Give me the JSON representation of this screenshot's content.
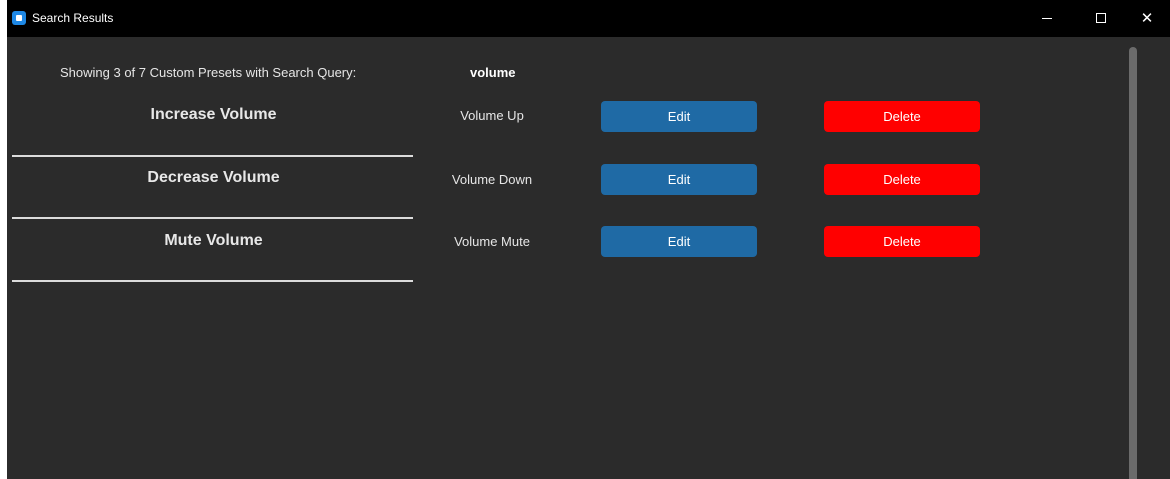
{
  "window": {
    "title": "Search Results",
    "controls": {
      "minimize": "minimize",
      "maximize": "maximize",
      "close": "✕"
    }
  },
  "search": {
    "summary": "Showing 3 of 7 Custom Presets with Search Query:",
    "query": "volume"
  },
  "presets": [
    {
      "name": "Increase Volume",
      "key": "Volume Up",
      "edit_label": "Edit",
      "delete_label": "Delete"
    },
    {
      "name": "Decrease Volume",
      "key": "Volume Down",
      "edit_label": "Edit",
      "delete_label": "Delete"
    },
    {
      "name": "Mute Volume",
      "key": "Volume Mute",
      "edit_label": "Edit",
      "delete_label": "Delete"
    }
  ],
  "colors": {
    "background": "#2b2b2b",
    "titlebar": "#000000",
    "edit_button": "#1f6aa5",
    "delete_button": "#ff0000"
  }
}
